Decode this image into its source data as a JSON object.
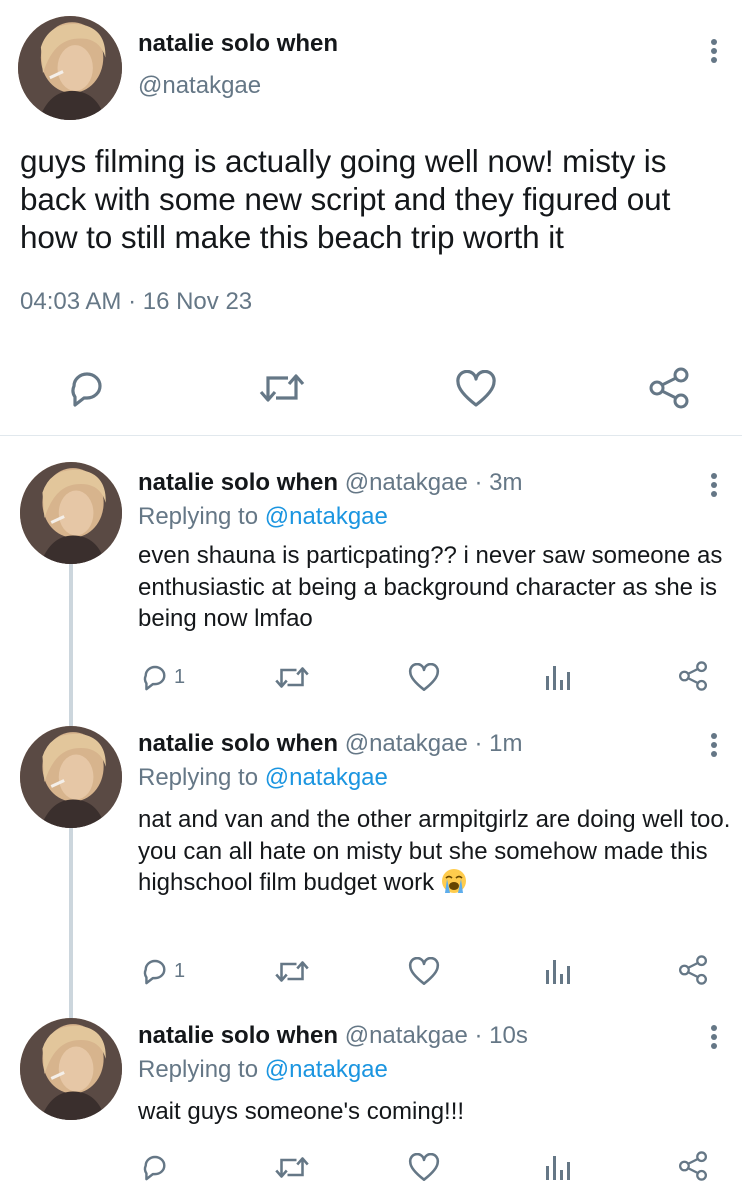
{
  "main_tweet": {
    "display_name": "natalie solo when",
    "handle": "@natakgae",
    "text": "guys filming is actually going well now! misty is back with some new script and they figured out how to still make this beach trip worth it",
    "timestamp": "04:03 AM · 16 Nov 23",
    "actions": [
      "reply-icon",
      "retweet-icon",
      "like-icon",
      "share-icon"
    ]
  },
  "replies": [
    {
      "display_name": "natalie solo when",
      "handle_time": "@natakgae · 3m",
      "replying_prefix": "Replying to ",
      "replying_to": "@natakgae",
      "text": "even shauna is particpating?? i never saw someone as enthusiastic at being a background character as she is being now lmfao",
      "reply_count": "1"
    },
    {
      "display_name": "natalie solo when",
      "handle_time": "@natakgae · 1m",
      "replying_prefix": "Replying to ",
      "replying_to": "@natakgae",
      "text": "nat and van and the other armpitgirlz are doing well too. you can all hate on misty but she somehow made this highschool film budget work",
      "emoji": "loudly-crying-face",
      "reply_count": "1"
    },
    {
      "display_name": "natalie solo when",
      "handle_time": "@natakgae · 10s",
      "replying_prefix": "Replying to ",
      "replying_to": "@natakgae",
      "text": "wait guys someone's coming!!!",
      "reply_count": ""
    }
  ],
  "colors": {
    "text": "#14171a",
    "muted": "#657786",
    "link": "#1b95e0",
    "divider": "#e1e8ed",
    "thread_line": "#ccd6dd"
  }
}
